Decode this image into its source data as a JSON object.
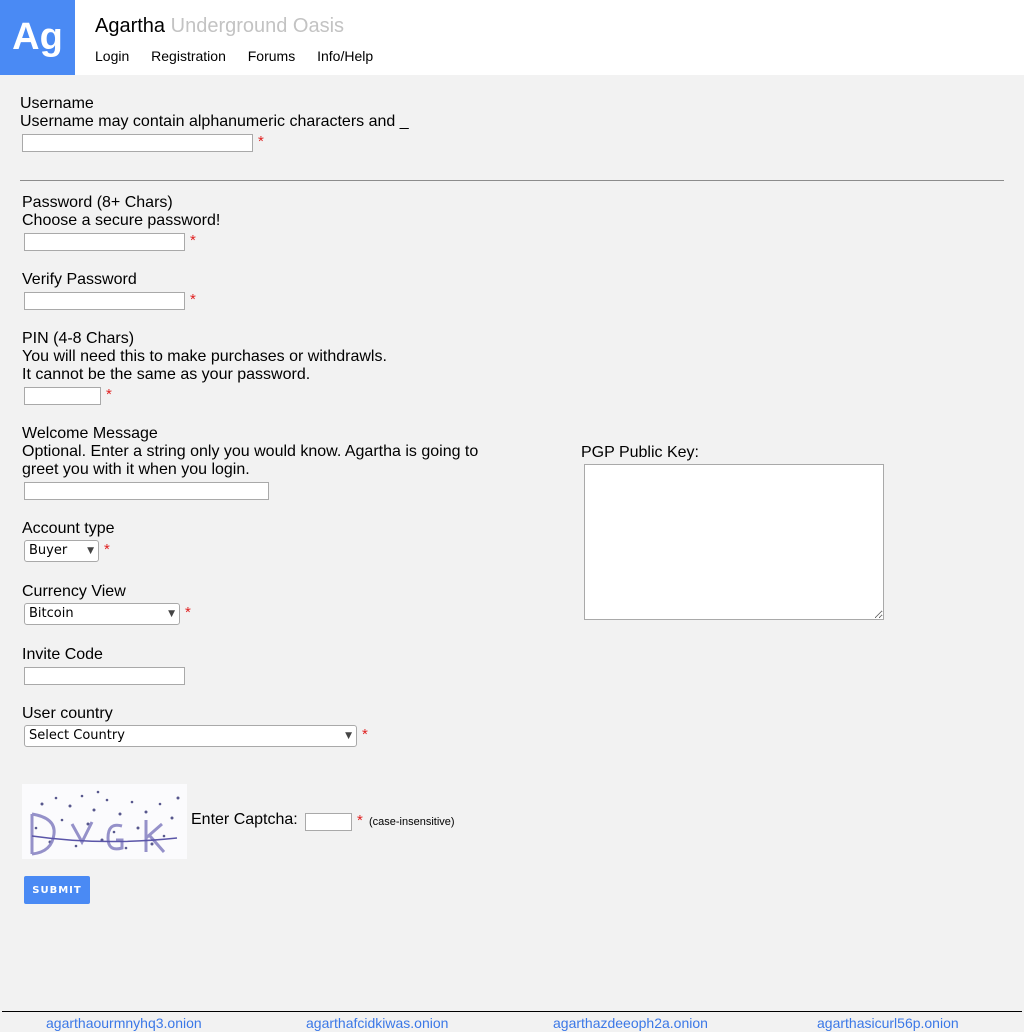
{
  "header": {
    "logo_text": "Ag",
    "title": "Agartha",
    "subtitle": "Underground Oasis",
    "nav": [
      "Login",
      "Registration",
      "Forums",
      "Info/Help"
    ]
  },
  "form": {
    "required_mark": "*",
    "username": {
      "label": "Username",
      "help": "Username may contain alphanumeric characters and _",
      "value": ""
    },
    "password": {
      "label": "Password (8+ Chars)",
      "help": "Choose a secure password!",
      "value": ""
    },
    "verify_password": {
      "label": "Verify Password",
      "value": ""
    },
    "pin": {
      "label": "PIN (4-8 Chars)",
      "help_lines": [
        "You will need this to make purchases or withdrawls.",
        "It cannot be the same as your password."
      ],
      "value": ""
    },
    "welcome_message": {
      "label": "Welcome Message",
      "help_lines": [
        "Optional. Enter a string only you would know. Agartha is going to",
        "greet you with it when you login."
      ],
      "value": ""
    },
    "account_type": {
      "label": "Account type",
      "selected": "Buyer"
    },
    "currency_view": {
      "label": "Currency View",
      "selected": "Bitcoin"
    },
    "invite_code": {
      "label": "Invite Code",
      "value": ""
    },
    "user_country": {
      "label": "User country",
      "selected": "Select Country"
    },
    "pgp_key": {
      "label": "PGP Public Key:",
      "value": ""
    },
    "captcha": {
      "label": "Enter Captcha:",
      "note": "(case-insensitive)",
      "value": ""
    },
    "submit_label": "SUBMIT"
  },
  "footer": {
    "links": [
      "agarthaourmnyhq3.onion",
      "agarthafcidkiwas.onion",
      "agarthazdeeoph2a.onion",
      "agarthasicurl56p.onion"
    ]
  },
  "colors": {
    "accent": "#4a8af4",
    "required": "#e02020",
    "link": "#3b78e7",
    "subtitle": "#c3c3c3"
  }
}
